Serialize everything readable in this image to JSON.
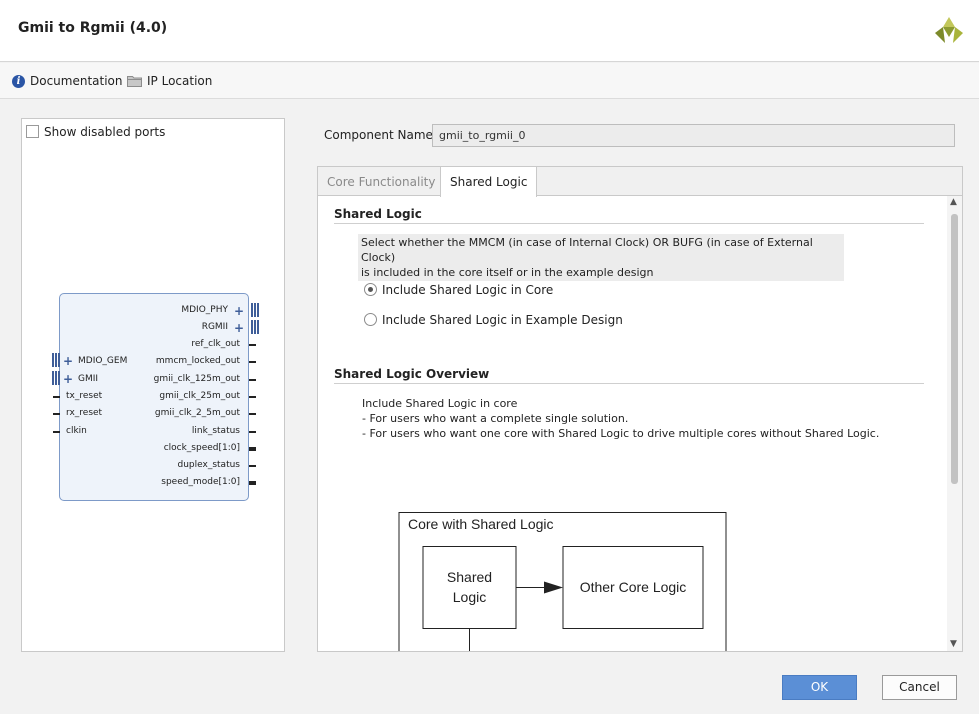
{
  "window": {
    "title": "Gmii to Rgmii (4.0)"
  },
  "links": {
    "documentation": "Documentation",
    "ip_location": "IP Location"
  },
  "left_panel": {
    "show_disabled_ports": "Show disabled ports",
    "block": {
      "right_ports": [
        "MDIO_PHY",
        "RGMII",
        "ref_clk_out",
        "mmcm_locked_out",
        "gmii_clk_125m_out",
        "gmii_clk_25m_out",
        "gmii_clk_2_5m_out",
        "link_status",
        "clock_speed[1:0]",
        "duplex_status",
        "speed_mode[1:0]"
      ],
      "left_ports": [
        "MDIO_GEM",
        "GMII",
        "tx_reset",
        "rx_reset",
        "clkin"
      ]
    }
  },
  "component": {
    "label": "Component Name",
    "value": "gmii_to_rgmii_0"
  },
  "tabs": [
    {
      "label": "Core Functionality",
      "active": false
    },
    {
      "label": "Shared Logic",
      "active": true
    }
  ],
  "shared_logic": {
    "title": "Shared Logic",
    "description_line1": "Select whether the MMCM (in case of Internal Clock) OR BUFG (in case of External Clock)",
    "description_line2": "is included in the core itself or in the example design",
    "options": [
      {
        "label": "Include Shared Logic in Core",
        "selected": true
      },
      {
        "label": "Include Shared Logic in Example Design",
        "selected": false
      }
    ]
  },
  "overview": {
    "title": "Shared Logic Overview",
    "line1": "Include Shared Logic in core",
    "line2": "- For users who want a complete single solution.",
    "line3": "- For users who want one core with Shared Logic to drive multiple cores without Shared Logic."
  },
  "diagram": {
    "outer_label": "Core with Shared Logic",
    "shared_box_line1": "Shared",
    "shared_box_line2": "Logic",
    "other_box": "Other Core Logic"
  },
  "buttons": {
    "ok": "OK",
    "cancel": "Cancel"
  },
  "colors": {
    "accent": "#5b8fd6",
    "block_border": "#7d9ac8",
    "block_fill": "#eef3fa",
    "info_icon": "#2a55a5"
  }
}
